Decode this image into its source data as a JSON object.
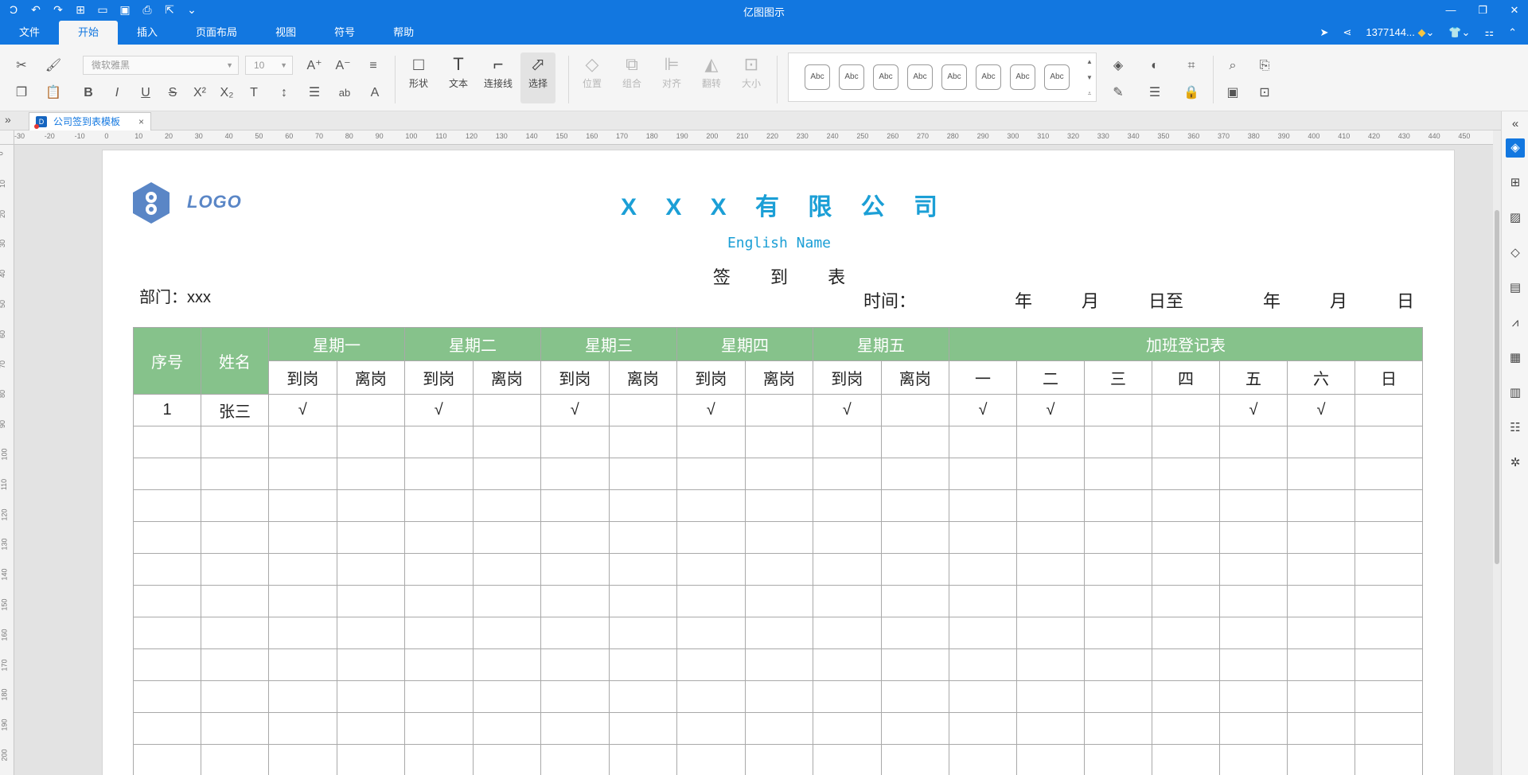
{
  "app": {
    "title": "亿图图示",
    "user": "1377144...",
    "window_controls": [
      "—",
      "❐",
      "✕"
    ]
  },
  "quick_access": [
    "undo",
    "redo",
    "new",
    "open",
    "save",
    "print",
    "export",
    "more"
  ],
  "menu": {
    "tabs": [
      "文件",
      "开始",
      "插入",
      "页面布局",
      "视图",
      "符号",
      "帮助"
    ],
    "active": "开始"
  },
  "ribbon": {
    "font_name": "微软雅黑",
    "font_size": "10",
    "big_buttons": [
      {
        "label": "形状",
        "icon": "rectangle-icon"
      },
      {
        "label": "文本",
        "icon": "text-icon"
      },
      {
        "label": "连接线",
        "icon": "connector-icon"
      },
      {
        "label": "选择",
        "icon": "pointer-icon"
      }
    ],
    "arrange_buttons": [
      {
        "label": "位置",
        "icon": "layers-icon"
      },
      {
        "label": "组合",
        "icon": "group-icon"
      },
      {
        "label": "对齐",
        "icon": "align-icon"
      },
      {
        "label": "翻转",
        "icon": "flip-icon"
      },
      {
        "label": "大小",
        "icon": "size-icon"
      }
    ],
    "style_label": "Abc"
  },
  "document": {
    "tab_label": "公司签到表模板",
    "tab_close": "×"
  },
  "ruler": {
    "h_labels": [
      "-30",
      "-20",
      "-10",
      "0",
      "10",
      "20",
      "30",
      "40",
      "50",
      "60",
      "70",
      "80",
      "90",
      "100",
      "110",
      "120",
      "130",
      "140",
      "150",
      "160",
      "170",
      "180",
      "190",
      "200",
      "210",
      "220",
      "230",
      "240",
      "250",
      "260",
      "270",
      "280",
      "290",
      "300",
      "310",
      "320",
      "330",
      "340",
      "350",
      "360",
      "370",
      "380",
      "390",
      "400",
      "410",
      "420",
      "430",
      "440",
      "450"
    ],
    "v_labels": [
      "0",
      "10",
      "20",
      "30",
      "40",
      "50",
      "60",
      "70",
      "80",
      "90",
      "100",
      "110",
      "120",
      "130",
      "140",
      "150",
      "160",
      "170",
      "180",
      "190",
      "200"
    ]
  },
  "sheet": {
    "logo_text": "LOGO",
    "company": "X X X 有 限 公 司",
    "english_name": "English Name",
    "title": "签 到 表",
    "dept_label": "部门：xxx",
    "time_label": "时间：",
    "date_parts": [
      "年",
      "月",
      "日至",
      "年",
      "月",
      "日"
    ],
    "headers": {
      "seq": "序号",
      "name": "姓名",
      "days": [
        "星期一",
        "星期二",
        "星期三",
        "星期四",
        "星期五"
      ],
      "in": "到岗",
      "out": "离岗",
      "overtime": "加班登记表",
      "overtime_days": [
        "一",
        "二",
        "三",
        "四",
        "五",
        "六",
        "日"
      ]
    },
    "rows": [
      [
        "1",
        "张三",
        "√",
        "",
        "√",
        "",
        "√",
        "",
        "√",
        "",
        "√",
        "",
        "√",
        "√",
        "",
        "",
        "√",
        "√",
        ""
      ]
    ],
    "empty_rows": 11
  },
  "colors": {
    "brand": "#1277e0",
    "header_green": "#86c28b",
    "title_blue": "#1b9fd6",
    "logo_blue": "#5a86c6"
  }
}
